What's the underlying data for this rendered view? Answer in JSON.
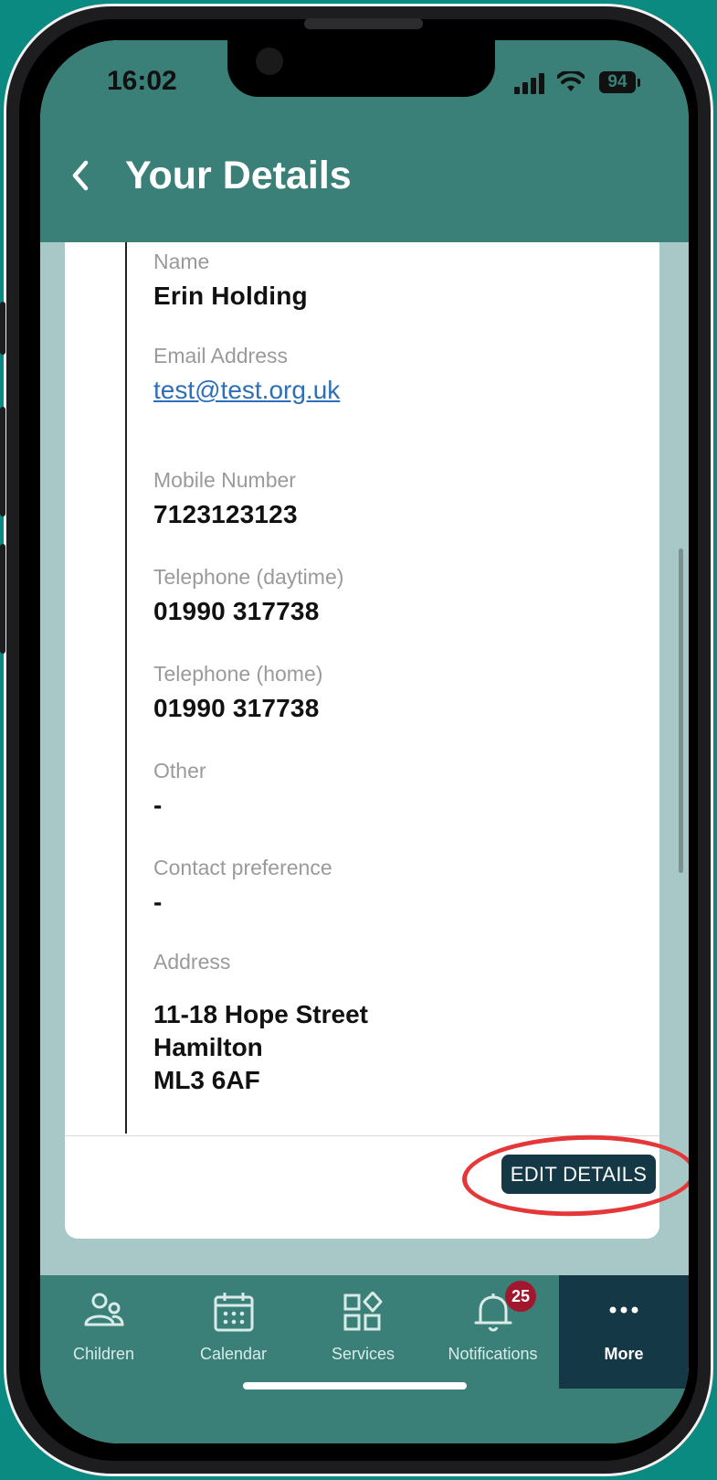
{
  "status_bar": {
    "time": "16:02",
    "battery": "94"
  },
  "header": {
    "title": "Your Details"
  },
  "fields": {
    "name": {
      "label": "Name",
      "value": "Erin Holding"
    },
    "email": {
      "label": "Email Address",
      "value": "test@test.org.uk"
    },
    "mobile": {
      "label": "Mobile Number",
      "value": "7123123123"
    },
    "tel_day": {
      "label": "Telephone (daytime)",
      "value": "01990 317738"
    },
    "tel_home": {
      "label": "Telephone (home)",
      "value": "01990 317738"
    },
    "other": {
      "label": "Other",
      "value": "-"
    },
    "contact_pref": {
      "label": "Contact preference",
      "value": "-"
    },
    "address": {
      "label": "Address",
      "lines": [
        "11-18 Hope Street",
        "Hamilton",
        "ML3 6AF"
      ]
    }
  },
  "actions": {
    "edit_label": "EDIT DETAILS"
  },
  "tabs": [
    {
      "label": "Children",
      "icon": "people-icon"
    },
    {
      "label": "Calendar",
      "icon": "calendar-icon"
    },
    {
      "label": "Services",
      "icon": "services-icon"
    },
    {
      "label": "Notifications",
      "icon": "bell-icon",
      "badge": "25"
    },
    {
      "label": "More",
      "icon": "more-icon",
      "active": true
    }
  ],
  "colors": {
    "accent": "#3b8078",
    "dark": "#143845",
    "badge": "#a0172e",
    "highlight": "#e53737"
  }
}
